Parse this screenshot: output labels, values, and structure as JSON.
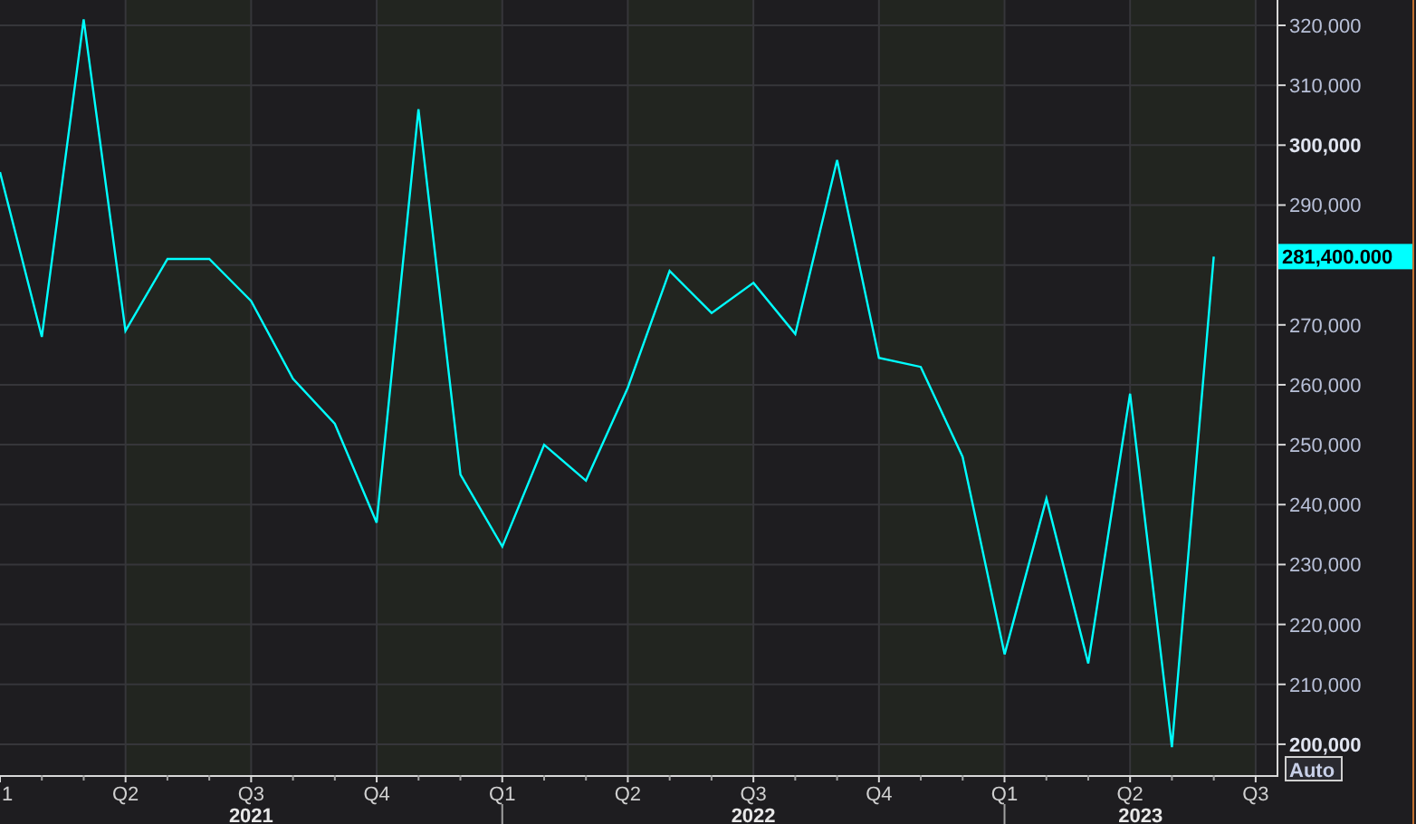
{
  "chart_data": {
    "type": "line",
    "grid": true,
    "categories": [
      "1",
      null,
      null,
      "Q2",
      null,
      null,
      "Q3",
      null,
      null,
      "Q4",
      null,
      null,
      "Q1",
      null,
      null,
      "Q2",
      null,
      null,
      "Q3",
      null,
      null,
      "Q4",
      null,
      null,
      "Q1",
      null,
      null,
      "Q2",
      null,
      null,
      "Q3"
    ],
    "series": [
      {
        "color": "#00ffff",
        "values": [
          295500,
          268000,
          321000,
          269000,
          281000,
          281000,
          274000,
          261000,
          253500,
          237000,
          306000,
          245000,
          233000,
          250000,
          244000,
          259500,
          279000,
          272000,
          277000,
          268500,
          297500,
          264500,
          263000,
          248000,
          215000,
          241000,
          213500,
          258500,
          199500,
          281400,
          null
        ]
      }
    ],
    "ylim": [
      194850,
      324230
    ],
    "yticks": [
      {
        "value": 200000,
        "label": "200,000"
      },
      {
        "value": 210000,
        "label": "210,000"
      },
      {
        "value": 220000,
        "label": "220,000"
      },
      {
        "value": 230000,
        "label": "230,000"
      },
      {
        "value": 240000,
        "label": "240,000"
      },
      {
        "value": 250000,
        "label": "250,000"
      },
      {
        "value": 260000,
        "label": "260,000"
      },
      {
        "value": 270000,
        "label": "270,000"
      },
      {
        "value": 290000,
        "label": "290,000"
      },
      {
        "value": 300000,
        "label": "300,000"
      },
      {
        "value": 310000,
        "label": "310,000"
      },
      {
        "value": 320000,
        "label": "320,000"
      }
    ]
  },
  "year_labels": [
    "2021",
    "2022",
    "2023"
  ],
  "last_value_label": "281,400.000",
  "scale_button": {
    "label": "Auto"
  }
}
